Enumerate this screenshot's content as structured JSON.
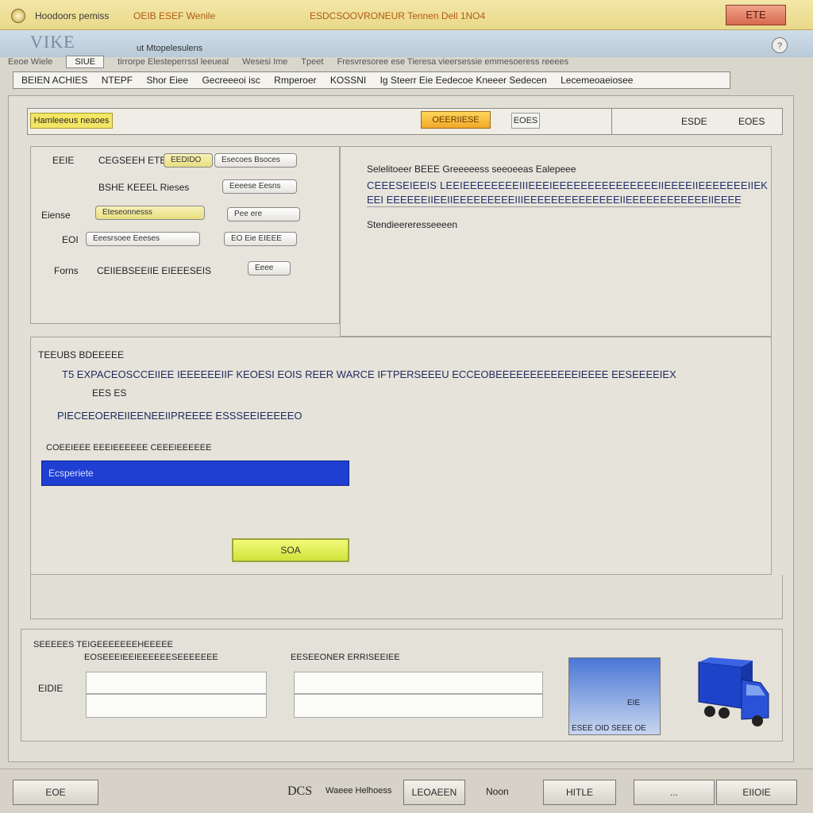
{
  "window": {
    "title_left": "Hoodoors pemiss",
    "title_mid": "OEIB ESEF Wenile",
    "title_doc": "ESDCSOOVRONEUR Tennen Dell 1NO4",
    "close_label": "ETE"
  },
  "app": {
    "logo": "VIKE",
    "subtitle": "ut Mtopelesulens"
  },
  "menu": {
    "items": [
      "Eeoe Wiele",
      "SIUE",
      "tirrorpe Elesteperrssl leeueal",
      "Wesesi Ime",
      "Tpeet",
      "Fresvresoree ese Tieresa vieersessie emmesoeress reeees"
    ]
  },
  "toolbar": {
    "items": [
      "BEIEN ACHIES",
      "NTEPF",
      "Shor Eiee",
      "Gecreeeoi isc",
      "Rmperoer",
      "KOSSNI",
      "Ig Steerr Eie Eedecoe Kneeer Sedecen",
      "Lecemeoaeiosee"
    ]
  },
  "top_panel": {
    "tag_yellow": "Hamleeeus neaoes",
    "tag_orange": "OEERIIESE",
    "small_btn": "EOES",
    "right_1": "ESDE",
    "right_2": "EOES"
  },
  "form": {
    "r1_label": "EEIE",
    "r1_mid": "CEGSEEH ETE",
    "r1_field_a": "EEDIDO",
    "r1_field_b": "Esecoes Bsoces",
    "r2_label": "BSHE KEEEL Rieses",
    "r2_field": "Eeeese Eesns",
    "r3_label": "Eiense",
    "r3_field_a": "Eteseonnesss",
    "r3_field_b": "Pee ere",
    "r4_label": "EOI",
    "r4_field_a": "Eeesrsoee Eeeses",
    "r4_field_b": "EO Eie EIEEE",
    "r5_label": "Forns",
    "r5_mid": "CEIIEBSEEIIE EIEEESEIS",
    "r5_field": "Eeee"
  },
  "info": {
    "heading": "Selelitoeer BEEE Greeeeess seeoeeas Ealepeee",
    "line1": "CEEESEIEEIS LEEIEEEEEEEEIIIEEEIEEEEEEEEEEEEEEEIIEEEEIIEEEEEEEIIEK",
    "line2": "EEI EEEEEEIIEEIIEEEEEEEEEIIIEEEEEEEEEEEEEEIIEEEEEEEEEEEEIIEEEE",
    "footer": "Stendieereresseeeen"
  },
  "mid": {
    "heading": "TEEUBS BDEEEEE",
    "line1": "T5  EXPACEOSCCEIIEE IEEEEEEIIF KEOESI EOIS REER WARCE IFTPERSEEEU ECCEOBEEEEEEEEEEEEIEEEE EESEEEEIEX",
    "line2": "EES ES",
    "line3": "PIECEEOEREIIEENEEIIPREEEE ESSSEEIEEEEEO",
    "line4": "COEEIEEE EEEIEEEEEE CEEEIEEEEEE",
    "selected": "Ecsperiete",
    "green_btn": "SOA"
  },
  "bottom": {
    "heading": "SEEEEES TEIGEEEEEEEHEEEEE",
    "col1": "EOSEEEIEEIEEEEEESEEEEEEE",
    "col2": "EESEEONER ERRISEEIEE",
    "label": "EIDIE",
    "preview_t1": "EIE",
    "preview_t2": "ESEE OID SEEE OE"
  },
  "status": {
    "left_btn": "EOE",
    "dcs": "DCS",
    "dcs_sub": "Waeee Helhoess",
    "mid_btn": "LEOAEEN",
    "noon": "Noon",
    "btn_file": "HITLE",
    "btn_blank": "...",
    "btn_cancel": "EIIOIE"
  },
  "colors": {
    "selection": "#1f3fd2",
    "accent_yellow": "#f4e565",
    "accent_orange": "#f1a82a",
    "close_red": "#d76a50",
    "truck_blue": "#1d43c8"
  }
}
